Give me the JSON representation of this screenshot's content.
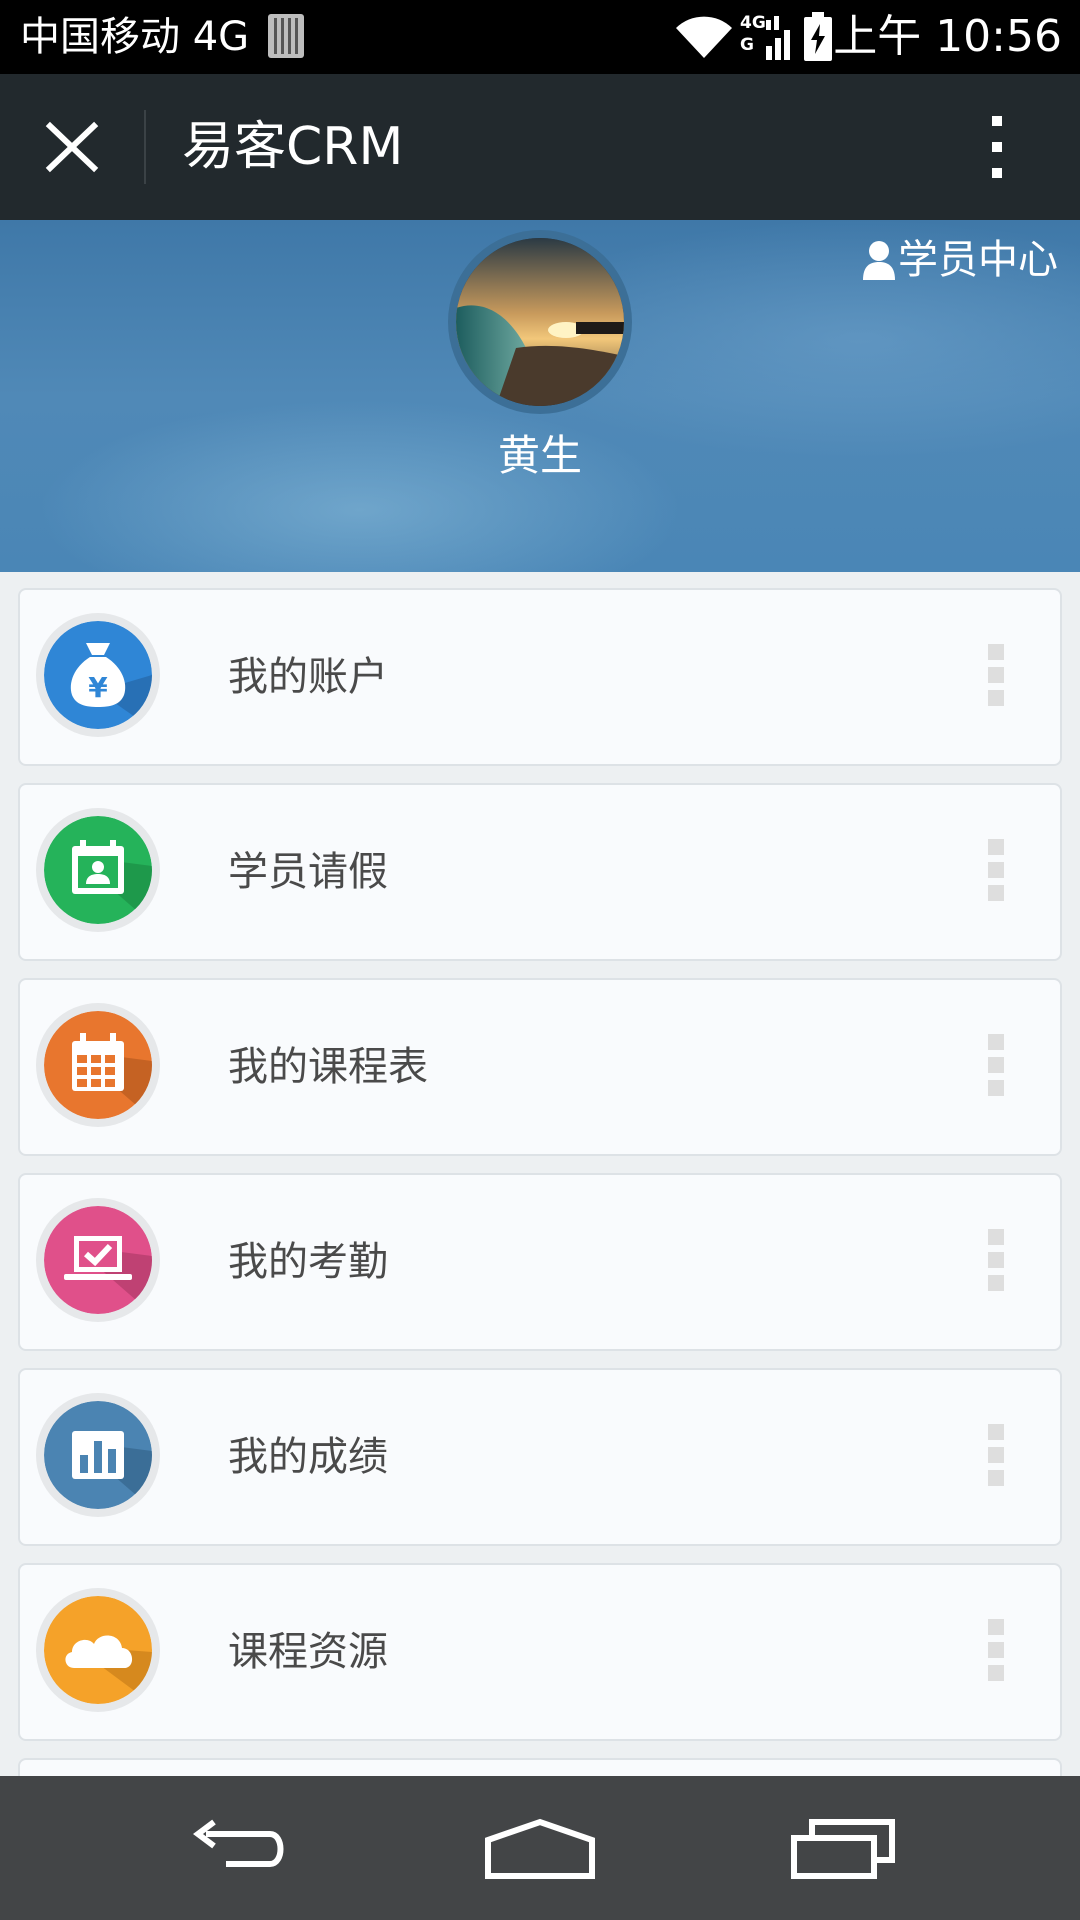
{
  "status_bar": {
    "carrier": "中国移动 4G",
    "network_label": "4G",
    "network_sub": "G",
    "time": "上午 10:56"
  },
  "app_bar": {
    "title": "易客CRM"
  },
  "header": {
    "student_center": "学员中心",
    "user_name": "黄生"
  },
  "menu": {
    "items": [
      {
        "label": "我的账户",
        "icon": "money-bag-icon",
        "color": "#2f86d6"
      },
      {
        "label": "学员请假",
        "icon": "calendar-person-icon",
        "color": "#25b35a"
      },
      {
        "label": "我的课程表",
        "icon": "calendar-grid-icon",
        "color": "#e8762e"
      },
      {
        "label": "我的考勤",
        "icon": "laptop-check-icon",
        "color": "#e0508a"
      },
      {
        "label": "我的成绩",
        "icon": "bar-chart-icon",
        "color": "#4b84b2"
      },
      {
        "label": "课程资源",
        "icon": "cloud-icon",
        "color": "#f5a229"
      }
    ]
  },
  "colors": {
    "status_bar": "#000000",
    "app_bar": "#22292d",
    "banner": "#4a86b6",
    "nav_bar": "#434547"
  }
}
